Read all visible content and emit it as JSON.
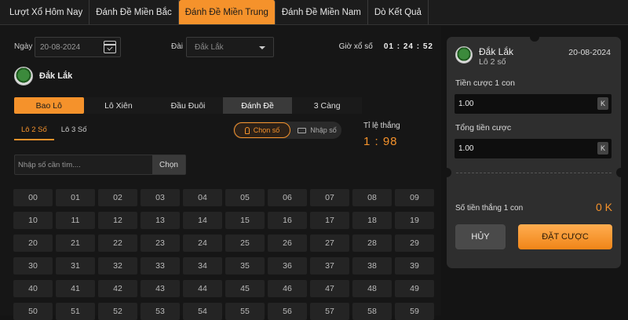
{
  "nav": {
    "tabs": [
      "Lượt Xổ Hôm Nay",
      "Đánh Đề Miền Bắc",
      "Đánh Đề Miền Trung",
      "Đánh Đề Miền Nam",
      "Dò Kết Quả"
    ],
    "active_index": 2
  },
  "filters": {
    "date_label": "Ngày",
    "date_value": "20-08-2024",
    "station_label": "Đài",
    "station_value": "Đắk Lắk",
    "draw_time_label": "Giờ xổ số",
    "countdown": "01 : 24 : 52"
  },
  "province": {
    "name": "Đắk Lắk"
  },
  "bet_types": {
    "items": [
      "Bao Lô",
      "Lô Xiên",
      "Đầu Đuôi",
      "Đánh Đề",
      "3 Càng"
    ],
    "active_index": 0
  },
  "sub_types": {
    "items": [
      "Lô 2 Số",
      "Lô 3 Số"
    ],
    "active_index": 0
  },
  "mode": {
    "pick": "Chọn số",
    "enter": "Nhập số"
  },
  "odds": {
    "label": "Tỉ lệ thắng",
    "value": "1 : 98"
  },
  "search": {
    "placeholder": "Nhập số cần tìm....",
    "button": "Chọn"
  },
  "numbers": [
    "00",
    "01",
    "02",
    "03",
    "04",
    "05",
    "06",
    "07",
    "08",
    "09",
    "10",
    "11",
    "12",
    "13",
    "14",
    "15",
    "16",
    "17",
    "18",
    "19",
    "20",
    "21",
    "22",
    "23",
    "24",
    "25",
    "26",
    "27",
    "28",
    "29",
    "30",
    "31",
    "32",
    "33",
    "34",
    "35",
    "36",
    "37",
    "38",
    "39",
    "40",
    "41",
    "42",
    "43",
    "44",
    "45",
    "46",
    "47",
    "48",
    "49",
    "50",
    "51",
    "52",
    "53",
    "54",
    "55",
    "56",
    "57",
    "58",
    "59"
  ],
  "ticket": {
    "province": "Đắk Lắk",
    "bet_kind": "Lô 2 số",
    "date": "20-08-2024",
    "stake_label": "Tiền cược 1 con",
    "stake_value": "1.00",
    "total_label": "Tổng tiền cược",
    "total_value": "1.00",
    "unit": "K",
    "win_label": "Số tiền thắng 1 con",
    "win_value": "0 K",
    "cancel": "HỦY",
    "submit": "ĐẶT CƯỢC"
  },
  "colors": {
    "accent": "#f5922b",
    "background": "#141414",
    "panel": "#2e2e2e"
  }
}
